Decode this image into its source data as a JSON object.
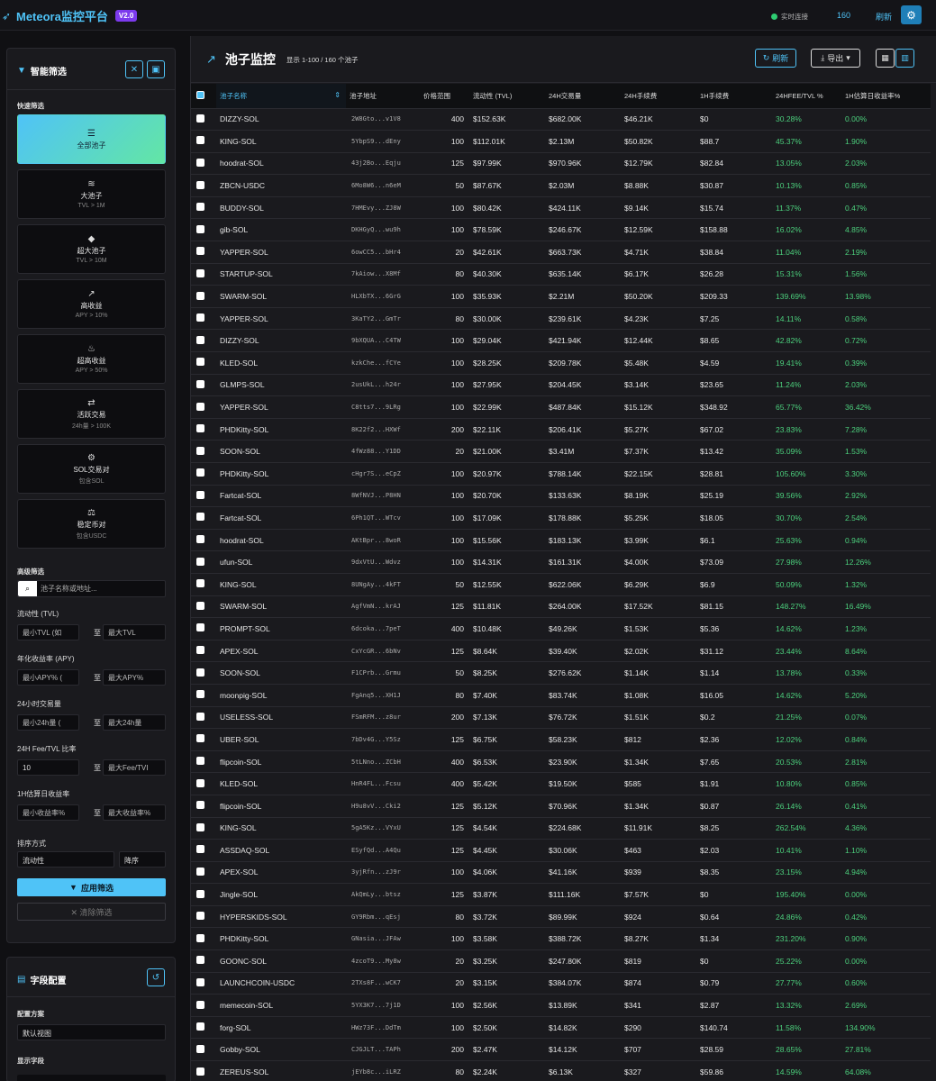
{
  "header": {
    "brand": "Meteora监控平台",
    "version": "V2.0",
    "status": "实时连接",
    "count": "160",
    "refresh": "刷新"
  },
  "sidebar": {
    "title": "智能筛选",
    "quick_label": "快速筛选",
    "quick": [
      {
        "label": "全部池子",
        "sub": "",
        "icon": "list-icon",
        "glyph": "☰"
      },
      {
        "label": "大池子",
        "sub": "TVL > 1M",
        "icon": "database-icon",
        "glyph": "≋"
      },
      {
        "label": "超大池子",
        "sub": "TVL > 10M",
        "icon": "diamond-icon",
        "glyph": "◆"
      },
      {
        "label": "高收益",
        "sub": "APY > 10%",
        "icon": "chart-line-icon",
        "glyph": "↗"
      },
      {
        "label": "超高收益",
        "sub": "APY > 50%",
        "icon": "fire-icon",
        "glyph": "♨"
      },
      {
        "label": "活跃交易",
        "sub": "24h量 > 100K",
        "icon": "exchange-icon",
        "glyph": "⇄"
      },
      {
        "label": "SOL交易对",
        "sub": "包含SOL",
        "icon": "gear-icon",
        "glyph": "⚙"
      },
      {
        "label": "稳定币对",
        "sub": "包含USDC",
        "icon": "scale-icon",
        "glyph": "⚖"
      }
    ],
    "advanced_label": "高级筛选",
    "search_placeholder": "池子名称或地址...",
    "ranges": [
      {
        "label": "流动性 (TVL)",
        "min_placeholder": "最小TVL (如",
        "max_placeholder": "最大TVL",
        "min_value": ""
      },
      {
        "label": "年化收益率 (APY)",
        "min_placeholder": "最小APY% (",
        "max_placeholder": "最大APY%",
        "min_value": ""
      },
      {
        "label": "24小时交易量",
        "min_placeholder": "最小24h量 (",
        "max_placeholder": "最大24h量",
        "min_value": ""
      },
      {
        "label": "24H Fee/TVL 比率",
        "min_placeholder": "",
        "max_placeholder": "最大Fee/TVI",
        "min_value": "10"
      },
      {
        "label": "1H估算日收益率",
        "min_placeholder": "最小收益率%",
        "max_placeholder": "最大收益率%",
        "min_value": ""
      }
    ],
    "range_sep": "至",
    "sort_label": "排序方式",
    "sort_field": "流动性",
    "sort_order": "降序",
    "apply": "应用筛选",
    "clear": "✕ 清除筛选"
  },
  "config": {
    "title": "字段配置",
    "scheme_label": "配置方案",
    "scheme_value": "默认视图",
    "display_label": "显示字段"
  },
  "main": {
    "title": "池子监控",
    "subtitle": "显示 1-100 / 160 个池子",
    "refresh": "刷新",
    "export": "导出",
    "columns": [
      "池子名称",
      "池子地址",
      "价格范围",
      "流动性 (TVL)",
      "24H交易量",
      "24H手续费",
      "1H手续费",
      "24HFEE/TVL %",
      "1H估算日收益率%"
    ],
    "rows": [
      [
        "DIZZY-SOL",
        "2W8Gto...v1V8",
        "400",
        "$152.63K",
        "$682.00K",
        "$46.21K",
        "$0",
        "30.28%",
        "0.00%"
      ],
      [
        "KING-SOL",
        "5YbpS9...dEny",
        "100",
        "$112.01K",
        "$2.13M",
        "$50.82K",
        "$88.7",
        "45.37%",
        "1.90%"
      ],
      [
        "hoodrat-SOL",
        "43j2Bo...Eqju",
        "125",
        "$97.99K",
        "$970.96K",
        "$12.79K",
        "$82.84",
        "13.05%",
        "2.03%"
      ],
      [
        "ZBCN-USDC",
        "6Mo8W6...n6eM",
        "50",
        "$87.67K",
        "$2.03M",
        "$8.88K",
        "$30.87",
        "10.13%",
        "0.85%"
      ],
      [
        "BUDDY-SOL",
        "7HMEvy...ZJ8W",
        "100",
        "$80.42K",
        "$424.11K",
        "$9.14K",
        "$15.74",
        "11.37%",
        "0.47%"
      ],
      [
        "gib-SOL",
        "DKHGyQ...wu9h",
        "100",
        "$78.59K",
        "$246.67K",
        "$12.59K",
        "$158.88",
        "16.02%",
        "4.85%"
      ],
      [
        "YAPPER-SOL",
        "6owCC5...bHr4",
        "20",
        "$42.61K",
        "$663.73K",
        "$4.71K",
        "$38.84",
        "11.04%",
        "2.19%"
      ],
      [
        "STARTUP-SOL",
        "7kAiow...X8Mf",
        "80",
        "$40.30K",
        "$635.14K",
        "$6.17K",
        "$26.28",
        "15.31%",
        "1.56%"
      ],
      [
        "SWARM-SOL",
        "HLXbTX...6GrG",
        "100",
        "$35.93K",
        "$2.21M",
        "$50.20K",
        "$209.33",
        "139.69%",
        "13.98%"
      ],
      [
        "YAPPER-SOL",
        "3KaTY2...GmTr",
        "80",
        "$30.00K",
        "$239.61K",
        "$4.23K",
        "$7.25",
        "14.11%",
        "0.58%"
      ],
      [
        "DIZZY-SOL",
        "9bXQUA...C4TW",
        "100",
        "$29.04K",
        "$421.94K",
        "$12.44K",
        "$8.65",
        "42.82%",
        "0.72%"
      ],
      [
        "KLED-SOL",
        "kzkChe...fCYe",
        "100",
        "$28.25K",
        "$209.78K",
        "$5.48K",
        "$4.59",
        "19.41%",
        "0.39%"
      ],
      [
        "GLMPS-SOL",
        "2usUkL...h24r",
        "100",
        "$27.95K",
        "$204.45K",
        "$3.14K",
        "$23.65",
        "11.24%",
        "2.03%"
      ],
      [
        "YAPPER-SOL",
        "C8tts7...9LRg",
        "100",
        "$22.99K",
        "$487.84K",
        "$15.12K",
        "$348.92",
        "65.77%",
        "36.42%"
      ],
      [
        "PHDKitty-SOL",
        "8K22f2...HXWf",
        "200",
        "$22.11K",
        "$206.41K",
        "$5.27K",
        "$67.02",
        "23.83%",
        "7.28%"
      ],
      [
        "SOON-SOL",
        "4fWz88...Y1DD",
        "20",
        "$21.00K",
        "$3.41M",
        "$7.37K",
        "$13.42",
        "35.09%",
        "1.53%"
      ],
      [
        "PHDKitty-SOL",
        "cHgr7S...eCpZ",
        "100",
        "$20.97K",
        "$788.14K",
        "$22.15K",
        "$28.81",
        "105.60%",
        "3.30%"
      ],
      [
        "Fartcat-SOL",
        "8WfNVJ...P8HN",
        "100",
        "$20.70K",
        "$133.63K",
        "$8.19K",
        "$25.19",
        "39.56%",
        "2.92%"
      ],
      [
        "Fartcat-SOL",
        "6Ph1QT...WTcv",
        "100",
        "$17.09K",
        "$178.88K",
        "$5.25K",
        "$18.05",
        "30.70%",
        "2.54%"
      ],
      [
        "hoodrat-SOL",
        "AKtBpr...8woR",
        "100",
        "$15.56K",
        "$183.13K",
        "$3.99K",
        "$6.1",
        "25.63%",
        "0.94%"
      ],
      [
        "ufun-SOL",
        "9dxVtU...Wdvz",
        "100",
        "$14.31K",
        "$161.31K",
        "$4.00K",
        "$73.09",
        "27.98%",
        "12.26%"
      ],
      [
        "KING-SOL",
        "8UNgAy...4kFT",
        "50",
        "$12.55K",
        "$622.06K",
        "$6.29K",
        "$6.9",
        "50.09%",
        "1.32%"
      ],
      [
        "SWARM-SOL",
        "AgfVmN...krAJ",
        "125",
        "$11.81K",
        "$264.00K",
        "$17.52K",
        "$81.15",
        "148.27%",
        "16.49%"
      ],
      [
        "PROMPT-SOL",
        "6dcoka...7peT",
        "400",
        "$10.48K",
        "$49.26K",
        "$1.53K",
        "$5.36",
        "14.62%",
        "1.23%"
      ],
      [
        "APEX-SOL",
        "CxYcGR...6bNv",
        "125",
        "$8.64K",
        "$39.40K",
        "$2.02K",
        "$31.12",
        "23.44%",
        "8.64%"
      ],
      [
        "SOON-SOL",
        "F1CPrb...Grmu",
        "50",
        "$8.25K",
        "$276.62K",
        "$1.14K",
        "$1.14",
        "13.78%",
        "0.33%"
      ],
      [
        "moonpig-SOL",
        "FgAnq5...XH1J",
        "80",
        "$7.40K",
        "$83.74K",
        "$1.08K",
        "$16.05",
        "14.62%",
        "5.20%"
      ],
      [
        "USELESS-SOL",
        "FSmRFM...z8ur",
        "200",
        "$7.13K",
        "$76.72K",
        "$1.51K",
        "$0.2",
        "21.25%",
        "0.07%"
      ],
      [
        "UBER-SOL",
        "7bDv4G...Y5Sz",
        "125",
        "$6.75K",
        "$58.23K",
        "$812",
        "$2.36",
        "12.02%",
        "0.84%"
      ],
      [
        "flipcoin-SOL",
        "5tLNno...ZCbH",
        "400",
        "$6.53K",
        "$23.90K",
        "$1.34K",
        "$7.65",
        "20.53%",
        "2.81%"
      ],
      [
        "KLED-SOL",
        "HnR4FL...Fcsu",
        "400",
        "$5.42K",
        "$19.50K",
        "$585",
        "$1.91",
        "10.80%",
        "0.85%"
      ],
      [
        "flipcoin-SOL",
        "H9u8vV...Cki2",
        "125",
        "$5.12K",
        "$70.96K",
        "$1.34K",
        "$0.87",
        "26.14%",
        "0.41%"
      ],
      [
        "KING-SOL",
        "5gA5Kz...VYxU",
        "125",
        "$4.54K",
        "$224.68K",
        "$11.91K",
        "$8.25",
        "262.54%",
        "4.36%"
      ],
      [
        "ASSDAQ-SOL",
        "ESyfQd...A4Qu",
        "125",
        "$4.45K",
        "$30.06K",
        "$463",
        "$2.03",
        "10.41%",
        "1.10%"
      ],
      [
        "APEX-SOL",
        "3yjRfn...zJ9r",
        "100",
        "$4.06K",
        "$41.16K",
        "$939",
        "$8.35",
        "23.15%",
        "4.94%"
      ],
      [
        "Jingle-SOL",
        "AkQmLy...btsz",
        "125",
        "$3.87K",
        "$111.16K",
        "$7.57K",
        "$0",
        "195.40%",
        "0.00%"
      ],
      [
        "HYPERSKIDS-SOL",
        "GY9Rbm...qEsj",
        "80",
        "$3.72K",
        "$89.99K",
        "$924",
        "$0.64",
        "24.86%",
        "0.42%"
      ],
      [
        "PHDKitty-SOL",
        "GNasia...JFAw",
        "100",
        "$3.58K",
        "$388.72K",
        "$8.27K",
        "$1.34",
        "231.20%",
        "0.90%"
      ],
      [
        "GOONC-SOL",
        "4zcoT9...My8w",
        "20",
        "$3.25K",
        "$247.80K",
        "$819",
        "$0",
        "25.22%",
        "0.00%"
      ],
      [
        "LAUNCHCOIN-USDC",
        "2TXs8F...wCK7",
        "20",
        "$3.15K",
        "$384.07K",
        "$874",
        "$0.79",
        "27.77%",
        "0.60%"
      ],
      [
        "memecoin-SOL",
        "5YX3K7...7j1D",
        "100",
        "$2.56K",
        "$13.89K",
        "$341",
        "$2.87",
        "13.32%",
        "2.69%"
      ],
      [
        "forg-SOL",
        "HWz73F...DdTm",
        "100",
        "$2.50K",
        "$14.82K",
        "$290",
        "$140.74",
        "11.58%",
        "134.90%"
      ],
      [
        "Gobby-SOL",
        "CJGJLT...TAPh",
        "200",
        "$2.47K",
        "$14.12K",
        "$707",
        "$28.59",
        "28.65%",
        "27.81%"
      ],
      [
        "ZEREUS-SOL",
        "jEYb8c...iLRZ",
        "80",
        "$2.24K",
        "$6.13K",
        "$327",
        "$59.86",
        "14.59%",
        "64.08%"
      ]
    ]
  }
}
